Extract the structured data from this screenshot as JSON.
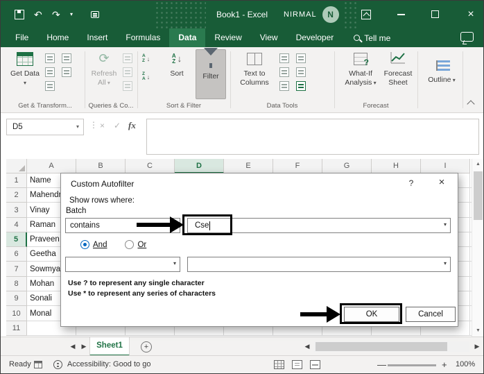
{
  "titlebar": {
    "title": "Book1 - Excel",
    "user": "NIRMAL",
    "avatar": "N"
  },
  "tabs": [
    "File",
    "Home",
    "Insert",
    "Formulas",
    "Data",
    "Review",
    "View",
    "Developer"
  ],
  "tell_me": "Tell me",
  "ribbon": {
    "get_data": "Get Data",
    "group1": "Get & Transform...",
    "refresh_all": "Refresh All",
    "group2": "Queries & Co...",
    "sort": "Sort",
    "filter": "Filter",
    "group3": "Sort & Filter",
    "text_to_columns": "Text to Columns",
    "group4": "Data Tools",
    "what_if": "What-If Analysis",
    "forecast_sheet": "Forecast Sheet",
    "group5": "Forecast",
    "outline": "Outline"
  },
  "formula_bar": {
    "name_box": "D5",
    "fx": "fx",
    "value": ""
  },
  "grid": {
    "col_headers": [
      "A",
      "B",
      "C",
      "D",
      "E",
      "F",
      "G",
      "H",
      "I"
    ],
    "row_headers": [
      "1",
      "2",
      "3",
      "4",
      "5",
      "6",
      "7",
      "8",
      "9",
      "10",
      "11"
    ],
    "a_values": [
      "Name",
      "Mahendra",
      "Vinay",
      "Raman",
      "Praveen",
      "Geetha",
      "Sowmya",
      "Mohan",
      "Sonali",
      "Monal",
      ""
    ]
  },
  "dialog": {
    "title": "Custom Autofilter",
    "help": "?",
    "prompt": "Show rows where:",
    "field_label": "Batch",
    "operator1": "contains",
    "value1": "Cse",
    "and_label": "And",
    "or_label": "Or",
    "hint1": "Use ? to represent any single character",
    "hint2": "Use * to represent any series of characters",
    "ok": "OK",
    "cancel": "Cancel"
  },
  "sheet_bar": {
    "tab": "Sheet1"
  },
  "status_bar": {
    "mode": "Ready",
    "accessibility": "Accessibility: Good to go",
    "zoom": "100%"
  },
  "colors": {
    "excel_green": "#185c37",
    "accent_green": "#1e7145",
    "selection_bg": "#d9e8e0",
    "radio_blue": "#0067c0",
    "annotation": "#000000"
  }
}
